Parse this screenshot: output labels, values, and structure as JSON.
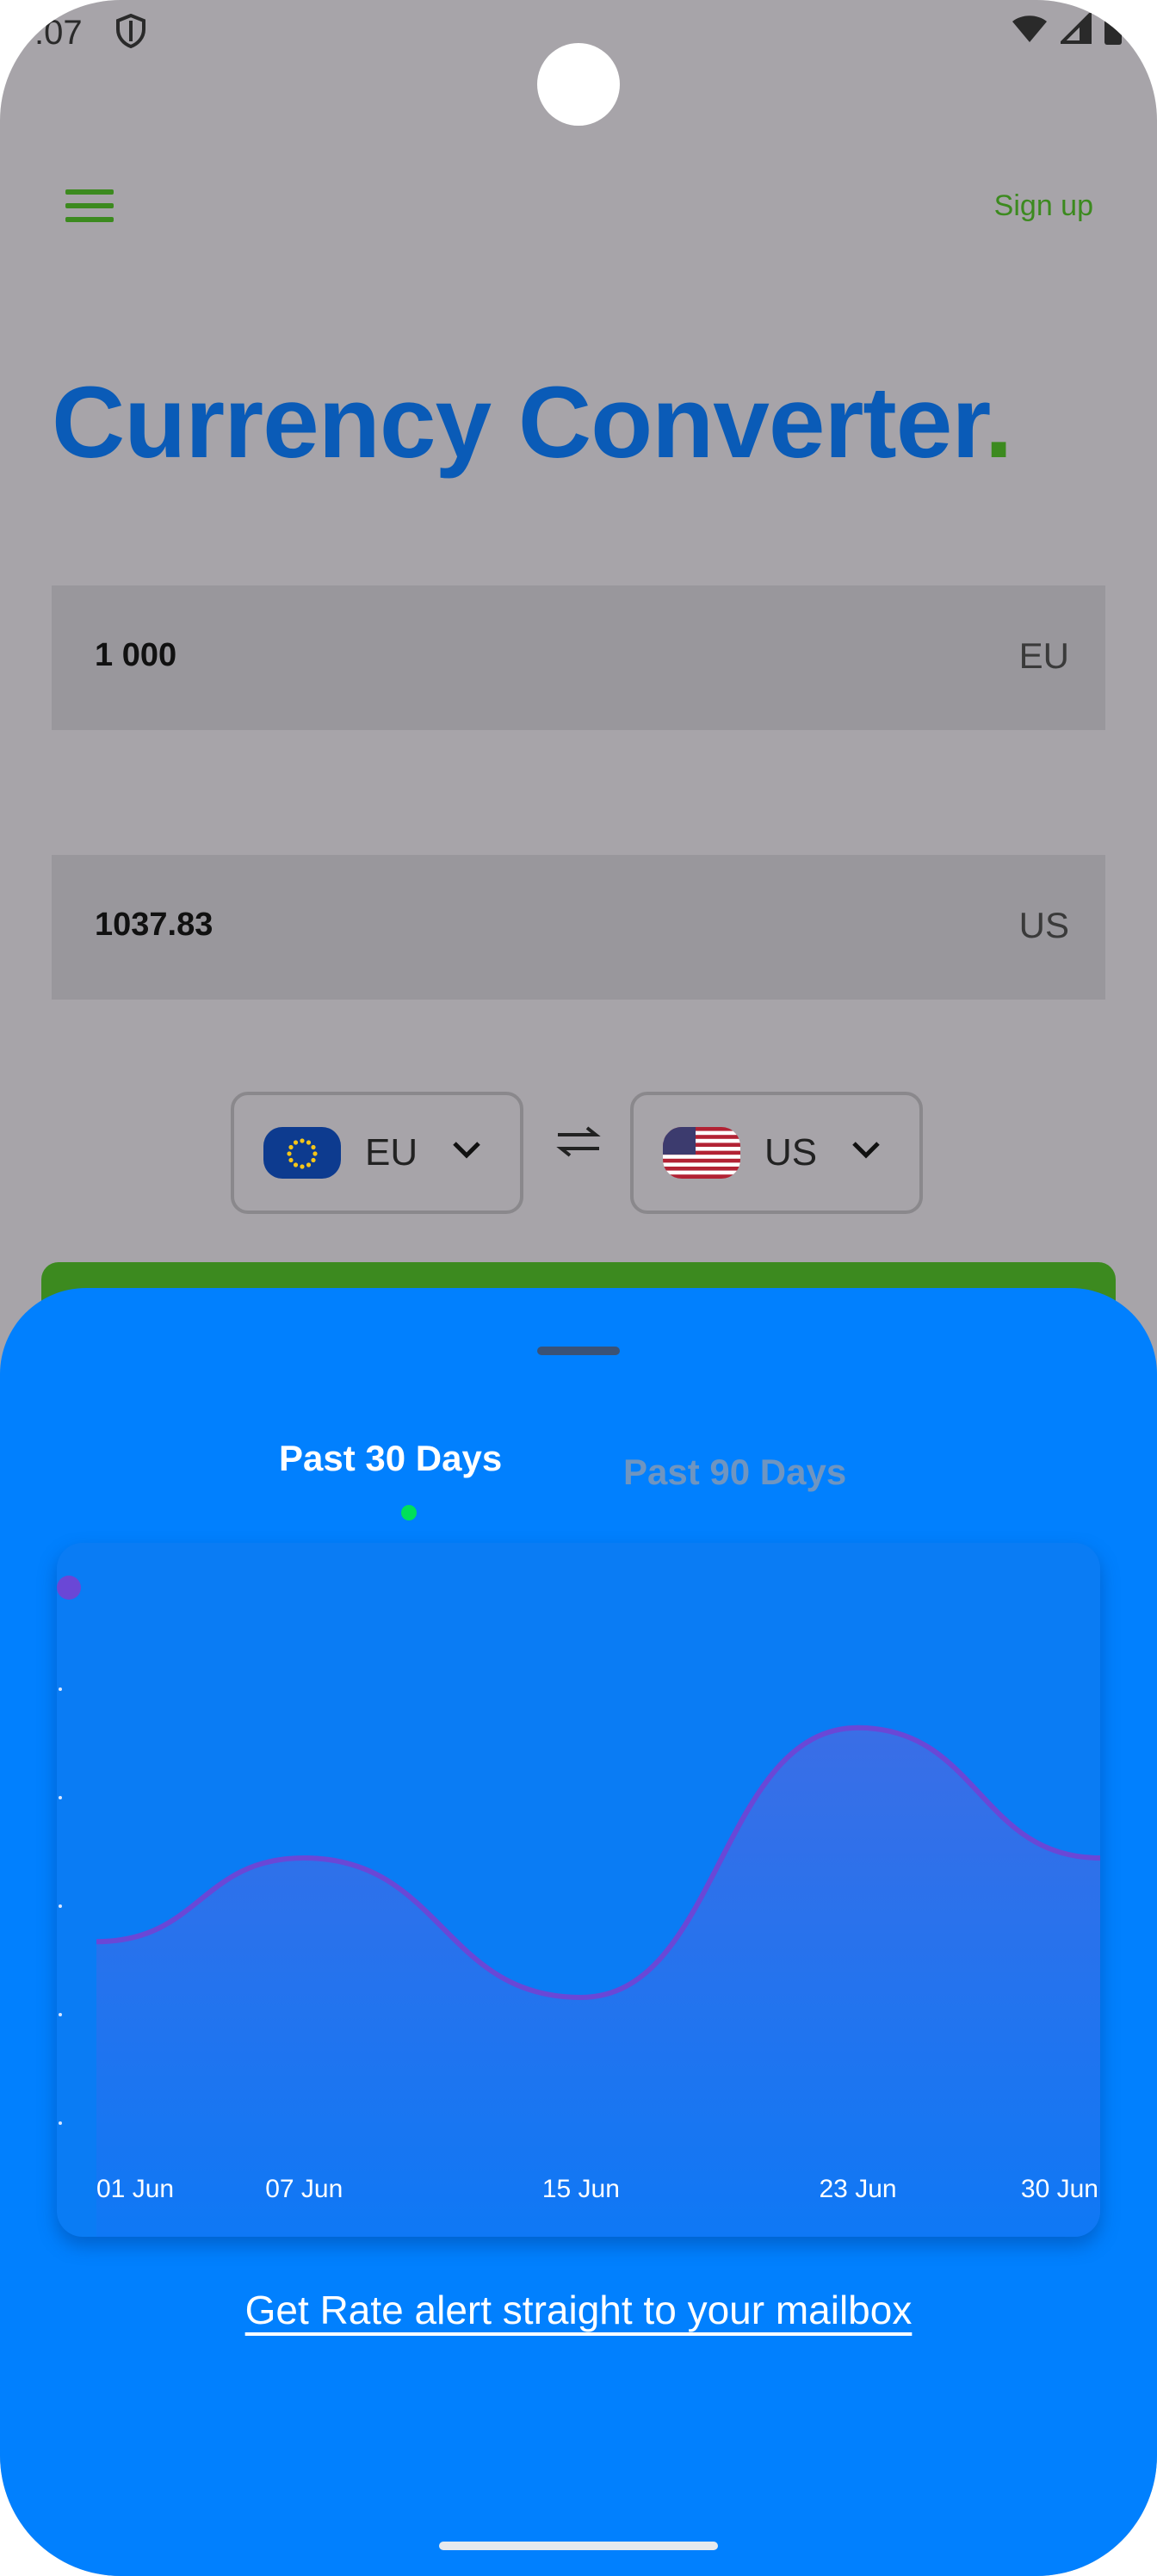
{
  "status_bar": {
    "time": ":07",
    "icons": [
      "shield-icon",
      "wifi-icon",
      "cell-signal-icon",
      "battery-icon"
    ]
  },
  "header": {
    "menu_icon": "hamburger-menu-icon",
    "signup_label": "Sign up"
  },
  "title": {
    "text": "Currency Converter",
    "dot": "."
  },
  "converter": {
    "from": {
      "amount": "1 000",
      "code": "EU"
    },
    "to": {
      "amount": "1037.83",
      "code": "US"
    }
  },
  "selectors": {
    "from": {
      "code": "EU",
      "flag": "eu-flag"
    },
    "to": {
      "code": "US",
      "flag": "us-flag"
    },
    "swap_icon": "swap-arrows-icon"
  },
  "sheet": {
    "tabs": [
      {
        "label": "Past 30 Days",
        "active": true
      },
      {
        "label": "Past 90 Days",
        "active": false
      }
    ],
    "alert_link": "Get Rate alert straight to your mailbox"
  },
  "chart_data": {
    "type": "area",
    "x_ticks": [
      "01 Jun",
      "07 Jun",
      "15 Jun",
      "23 Jun",
      "30 Jun"
    ],
    "x": [
      1,
      7,
      15,
      23,
      30
    ],
    "values": [
      0.42,
      0.6,
      0.3,
      0.88,
      0.6
    ],
    "y_range": [
      0,
      1
    ],
    "grid": false,
    "line_color": "#6a47d6"
  },
  "colors": {
    "brand_blue": "#0a5bb7",
    "accent_green": "#3c8a1f",
    "sheet_blue": "#0180fe",
    "indicator_green": "#00e05a"
  }
}
